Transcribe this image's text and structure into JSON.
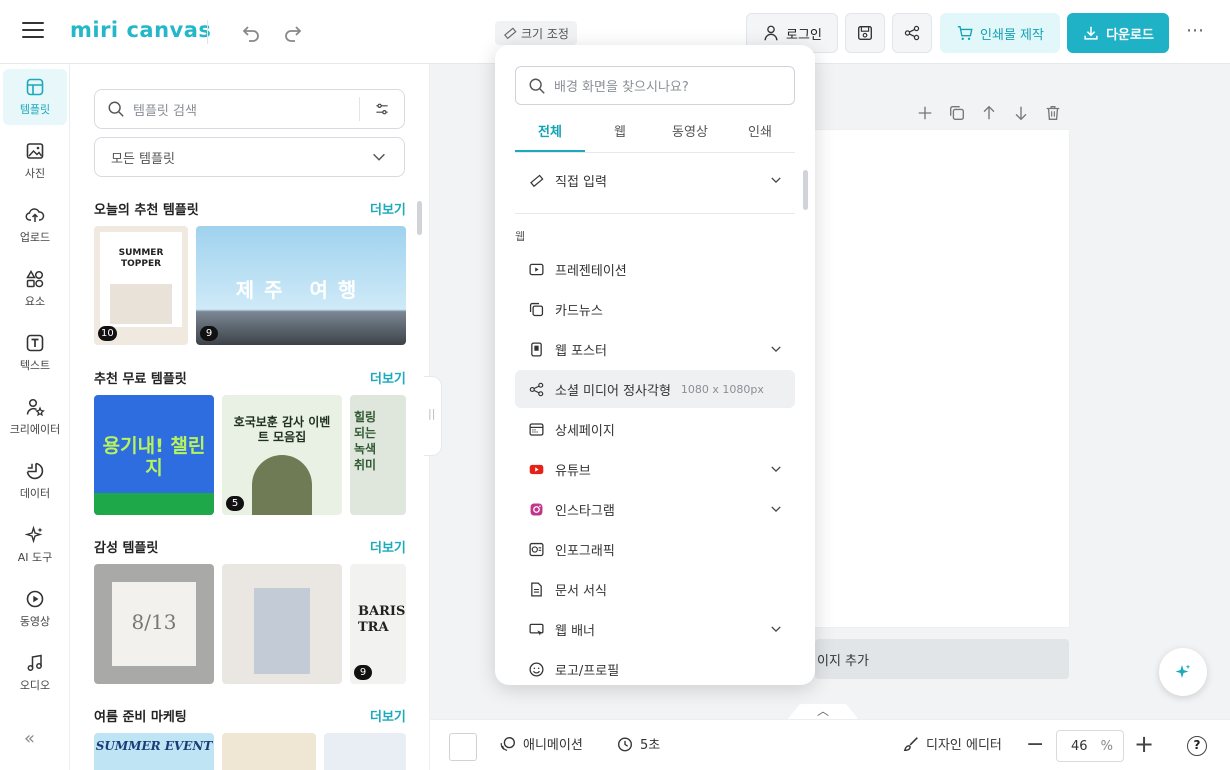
{
  "header": {
    "logo": "miri canvas",
    "resize_label": "크기 조정",
    "login_label": "로그인",
    "print_label": "인쇄물 제작",
    "download_label": "다운로드",
    "more": "⋯"
  },
  "rail": {
    "items": [
      {
        "label": "템플릿",
        "icon": "template-icon"
      },
      {
        "label": "사진",
        "icon": "photo-icon"
      },
      {
        "label": "업로드",
        "icon": "upload-icon"
      },
      {
        "label": "요소",
        "icon": "elements-icon"
      },
      {
        "label": "텍스트",
        "icon": "text-icon"
      },
      {
        "label": "크리에이터",
        "icon": "creator-icon"
      },
      {
        "label": "데이터",
        "icon": "data-icon"
      },
      {
        "label": "AI 도구",
        "icon": "ai-icon"
      },
      {
        "label": "동영상",
        "icon": "video-icon"
      },
      {
        "label": "오디오",
        "icon": "audio-icon"
      }
    ],
    "collapse": "«"
  },
  "panel": {
    "search_placeholder": "템플릿 검색",
    "select_value": "모든 템플릿",
    "more_label": "더보기",
    "sections": [
      {
        "title": "오늘의 추천 템플릿",
        "thumbs": [
          {
            "title": "SUMMER TOPPER",
            "count": "10"
          },
          {
            "title": "제주 여행",
            "count": "9"
          }
        ]
      },
      {
        "title": "추천 무료 템플릿",
        "thumbs": [
          {
            "title": "용기내! 챌린지",
            "count": ""
          },
          {
            "title": "호국보훈 감사 이벤트 모음집",
            "count": "5"
          },
          {
            "title": "힐링 되는 녹색 취미",
            "count": ""
          }
        ]
      },
      {
        "title": "감성 템플릿",
        "thumbs": [
          {
            "title": "8/13",
            "count": ""
          },
          {
            "title": "",
            "count": ""
          },
          {
            "title": "BARIS TRA",
            "count": "9"
          }
        ]
      },
      {
        "title": "여름 준비 마케팅",
        "thumbs": [
          {
            "title": "SUMMER EVENT",
            "count": ""
          }
        ]
      }
    ]
  },
  "workspace": {
    "add_page_label": "이지 추가"
  },
  "bottom": {
    "animation_label": "애니메이션",
    "duration_label": "5초",
    "editor_label": "디자인 에디터",
    "zoom_value": "46",
    "zoom_unit": "%",
    "help": "?"
  },
  "popup": {
    "search_placeholder": "배경 화면을 찾으시나요?",
    "tabs": [
      "전체",
      "웹",
      "동영상",
      "인쇄"
    ],
    "direct_input": "직접 입력",
    "group_label": "웹",
    "items": [
      {
        "label": "프레젠테이션",
        "size": "",
        "icon": "presentation-icon",
        "expand": false
      },
      {
        "label": "카드뉴스",
        "size": "",
        "icon": "cardnews-icon",
        "expand": false
      },
      {
        "label": "웹 포스터",
        "size": "",
        "icon": "poster-icon",
        "expand": true
      },
      {
        "label": "소셜 미디어 정사각형",
        "size": "1080 x 1080px",
        "icon": "share-icon",
        "expand": false
      },
      {
        "label": "상세페이지",
        "size": "",
        "icon": "detail-page-icon",
        "expand": false
      },
      {
        "label": "유튜브",
        "size": "",
        "icon": "youtube-icon",
        "expand": true
      },
      {
        "label": "인스타그램",
        "size": "",
        "icon": "instagram-icon",
        "expand": true
      },
      {
        "label": "인포그래픽",
        "size": "",
        "icon": "infographic-icon",
        "expand": false
      },
      {
        "label": "문서 서식",
        "size": "",
        "icon": "document-icon",
        "expand": false
      },
      {
        "label": "웹 배너",
        "size": "",
        "icon": "banner-icon",
        "expand": true
      },
      {
        "label": "로고/프로필",
        "size": "",
        "icon": "logo-profile-icon",
        "expand": false
      }
    ]
  },
  "colors": {
    "accent": "#1ba9bb",
    "download_bg": "#1fb2c6",
    "print_bg": "#e2f7fa"
  }
}
